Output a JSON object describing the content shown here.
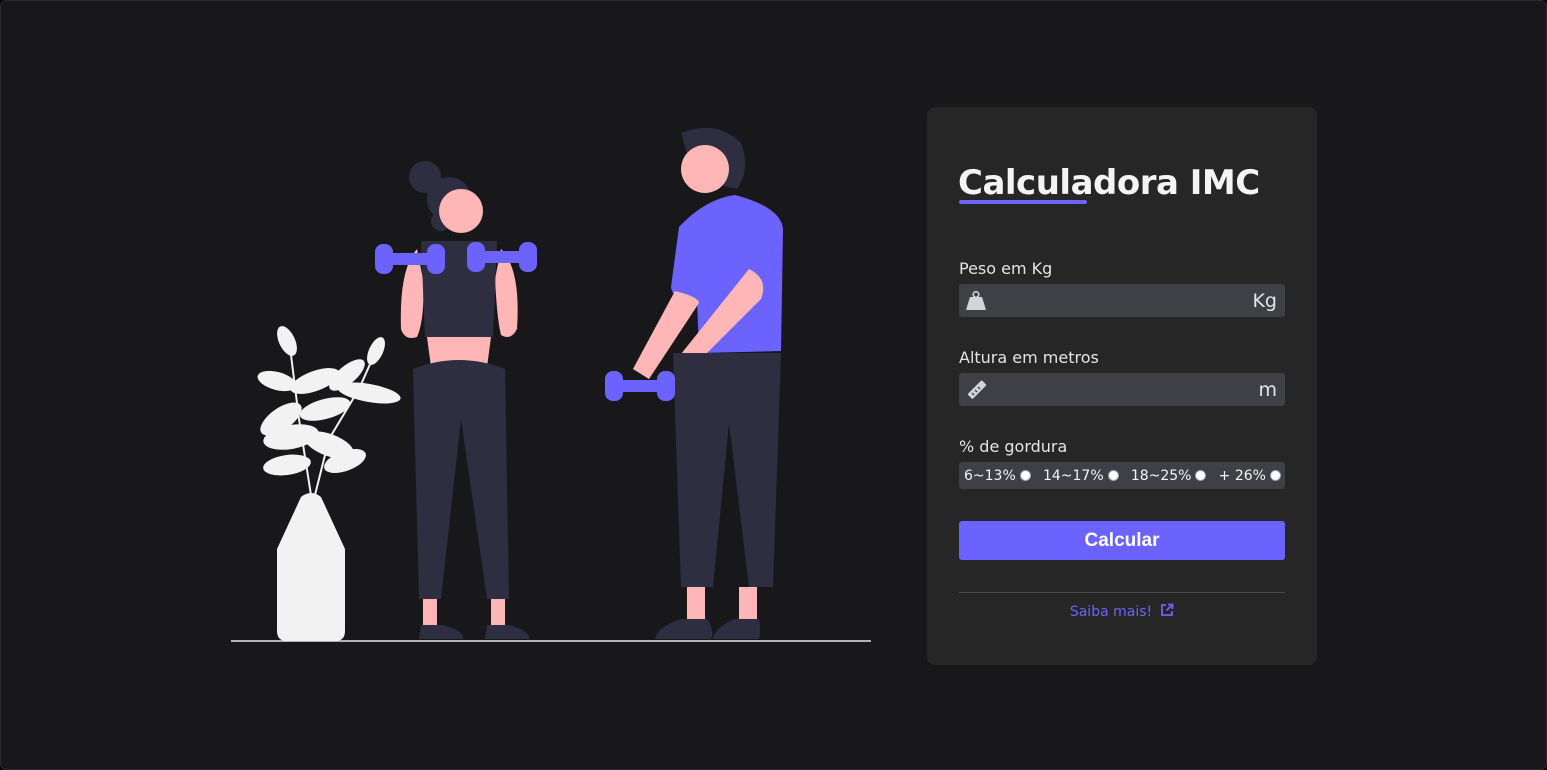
{
  "colors": {
    "background": "#18181b",
    "card": "#262626",
    "accent": "#6c63ff",
    "input": "#3f3f46"
  },
  "illustration": {
    "icon": "workout-illustration"
  },
  "calculator": {
    "title": "Calculadora IMC",
    "weight": {
      "label": "Peso em Kg",
      "value": "",
      "unit": "Kg",
      "icon": "weight-icon"
    },
    "height": {
      "label": "Altura em metros",
      "value": "",
      "unit": "m",
      "icon": "ruler-icon"
    },
    "fat": {
      "label": "% de gordura",
      "options": [
        "6~13%",
        "14~17%",
        "18~25%",
        "+ 26%"
      ]
    },
    "button_label": "Calcular",
    "link_label": "Saiba mais!",
    "link_icon": "external-link-icon"
  }
}
